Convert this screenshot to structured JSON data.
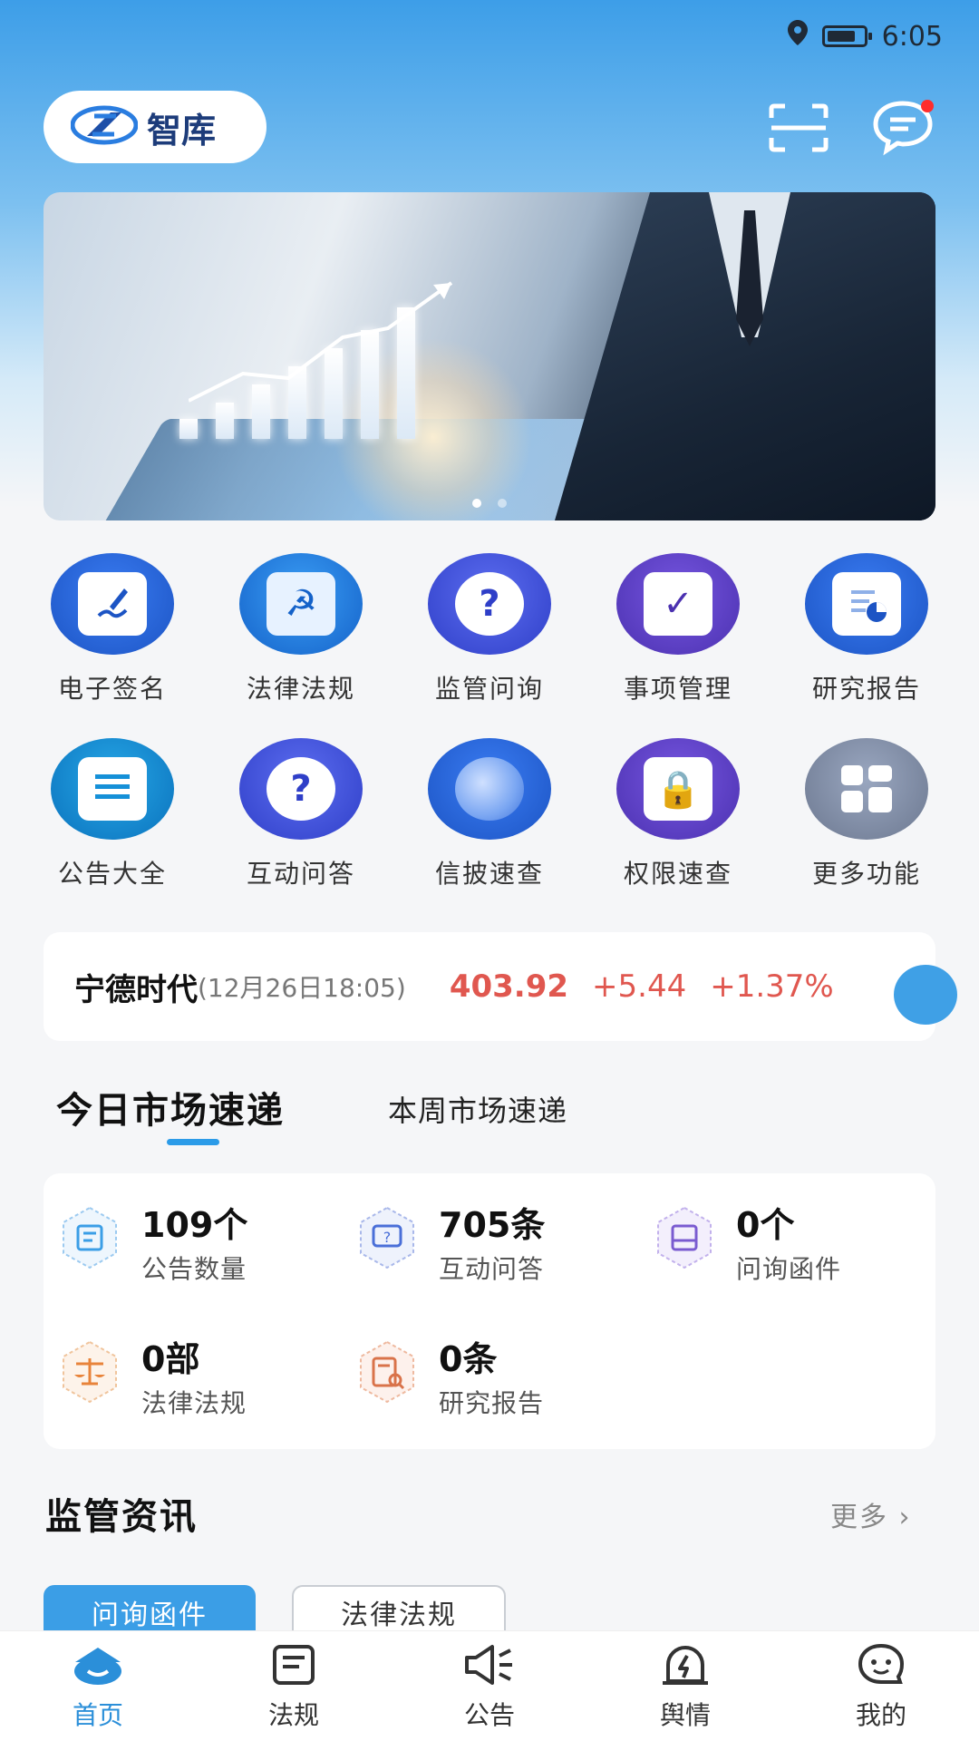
{
  "status_bar": {
    "time": "6:05"
  },
  "header": {
    "app_name": "智库"
  },
  "banner": {
    "slides": 2,
    "active_slide": 1
  },
  "quick_grid": [
    {
      "label": "电子签名",
      "icon": "signature-icon",
      "color": "#2c6ae0"
    },
    {
      "label": "法律法规",
      "icon": "law-icon",
      "color": "#1b7fe0"
    },
    {
      "label": "监管问询",
      "icon": "question-icon",
      "color": "#3f55e0"
    },
    {
      "label": "事项管理",
      "icon": "calendar-check-icon",
      "color": "#5a3fcc"
    },
    {
      "label": "研究报告",
      "icon": "report-chart-icon",
      "color": "#2c6ae0"
    },
    {
      "label": "公告大全",
      "icon": "document-icon",
      "color": "#1590d8"
    },
    {
      "label": "互动问答",
      "icon": "qa-bubble-icon",
      "color": "#3f55e0"
    },
    {
      "label": "信披速查",
      "icon": "magnifier-icon",
      "color": "#1c4fc7"
    },
    {
      "label": "权限速查",
      "icon": "lock-search-icon",
      "color": "#5a3fcc"
    },
    {
      "label": "更多功能",
      "icon": "grid-more-icon",
      "color": "#7d8aa3"
    }
  ],
  "stock": {
    "name": "宁德时代",
    "time": "(12月26日18:05)",
    "price": "403.92",
    "change": "+5.44",
    "change_pct": "+1.37%"
  },
  "market_tabs": {
    "today": "今日市场速递",
    "week": "本周市场速递"
  },
  "stats": [
    {
      "value": "109个",
      "label": "公告数量",
      "icon": "announcement-icon",
      "color": "#3b9ee6"
    },
    {
      "value": "705条",
      "label": "互动问答",
      "icon": "qa-icon",
      "color": "#4a6fd8"
    },
    {
      "value": "0个",
      "label": "问询函件",
      "icon": "inbox-icon",
      "color": "#7a5bd0"
    },
    {
      "value": "0部",
      "label": "法律法规",
      "icon": "scale-icon",
      "color": "#e8833a"
    },
    {
      "value": "0条",
      "label": "研究报告",
      "icon": "report-search-icon",
      "color": "#d9734a"
    }
  ],
  "news": {
    "title": "监管资讯",
    "more": "更多",
    "chips": [
      "问询函件",
      "法律法规"
    ]
  },
  "bottom_nav": [
    {
      "label": "首页",
      "icon": "home-icon",
      "active": true
    },
    {
      "label": "法规",
      "icon": "regulation-icon",
      "active": false
    },
    {
      "label": "公告",
      "icon": "megaphone-icon",
      "active": false
    },
    {
      "label": "舆情",
      "icon": "alarm-icon",
      "active": false
    },
    {
      "label": "我的",
      "icon": "profile-icon",
      "active": false
    }
  ]
}
